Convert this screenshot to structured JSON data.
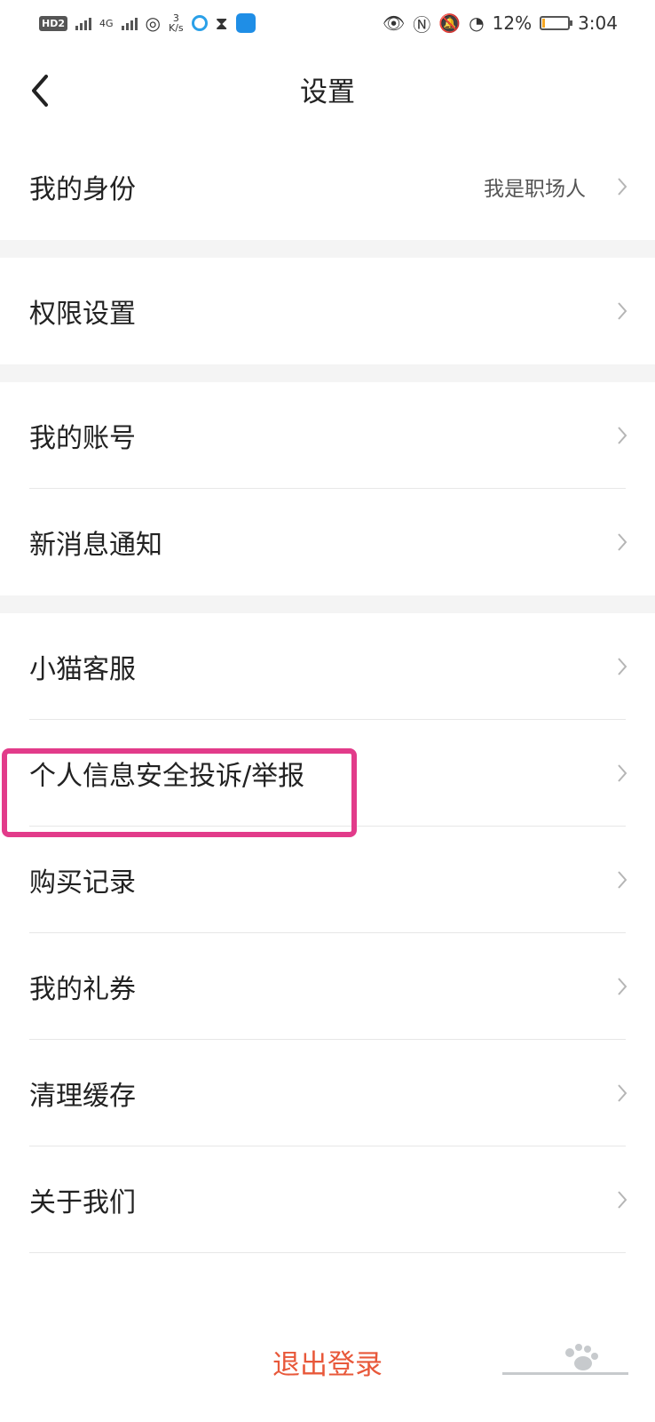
{
  "status_bar": {
    "hd_label": "HD",
    "hd_sub": "2",
    "net_4g": "4G",
    "speed_value": "3",
    "speed_unit": "K/s",
    "battery_percent": "12%",
    "battery_level": 0.12,
    "time": "3:04"
  },
  "header": {
    "title": "设置"
  },
  "groups": [
    {
      "items": [
        {
          "label": "我的身份",
          "value": "我是职场人"
        }
      ]
    },
    {
      "items": [
        {
          "label": "权限设置"
        }
      ]
    },
    {
      "items": [
        {
          "label": "我的账号"
        },
        {
          "label": "新消息通知"
        }
      ]
    },
    {
      "items": [
        {
          "label": "小猫客服"
        },
        {
          "label": "个人信息安全投诉/举报"
        },
        {
          "label": "购买记录"
        },
        {
          "label": "我的礼券"
        },
        {
          "label": "清理缓存"
        },
        {
          "label": "关于我们"
        }
      ]
    }
  ],
  "footer": {
    "logout_label": "退出登录"
  },
  "colors": {
    "accent": "#e8583a",
    "highlight": "#e23b8a",
    "separator": "#f4f4f4"
  }
}
